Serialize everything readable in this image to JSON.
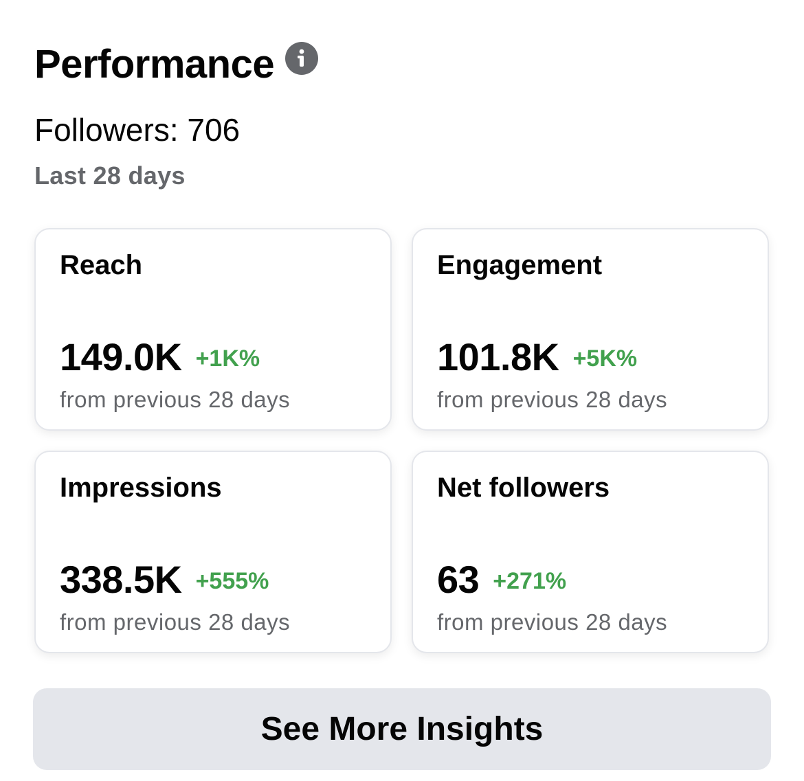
{
  "header": {
    "title": "Performance",
    "info_icon": "info-icon"
  },
  "summary": {
    "followers_text": "Followers: 706",
    "period_text": "Last 28 days"
  },
  "cards": [
    {
      "title": "Reach",
      "value": "149.0K",
      "change": "+1K%",
      "subtext": "from previous 28 days"
    },
    {
      "title": "Engagement",
      "value": "101.8K",
      "change": "+5K%",
      "subtext": "from previous 28 days"
    },
    {
      "title": "Impressions",
      "value": "338.5K",
      "change": "+555%",
      "subtext": "from previous 28 days"
    },
    {
      "title": "Net followers",
      "value": "63",
      "change": "+271%",
      "subtext": "from previous 28 days"
    }
  ],
  "button": {
    "label": "See More Insights"
  },
  "colors": {
    "positive_change": "#42a14e",
    "secondary_text": "#65676b",
    "button_background": "#e4e6eb",
    "card_border": "#e4e6eb"
  }
}
